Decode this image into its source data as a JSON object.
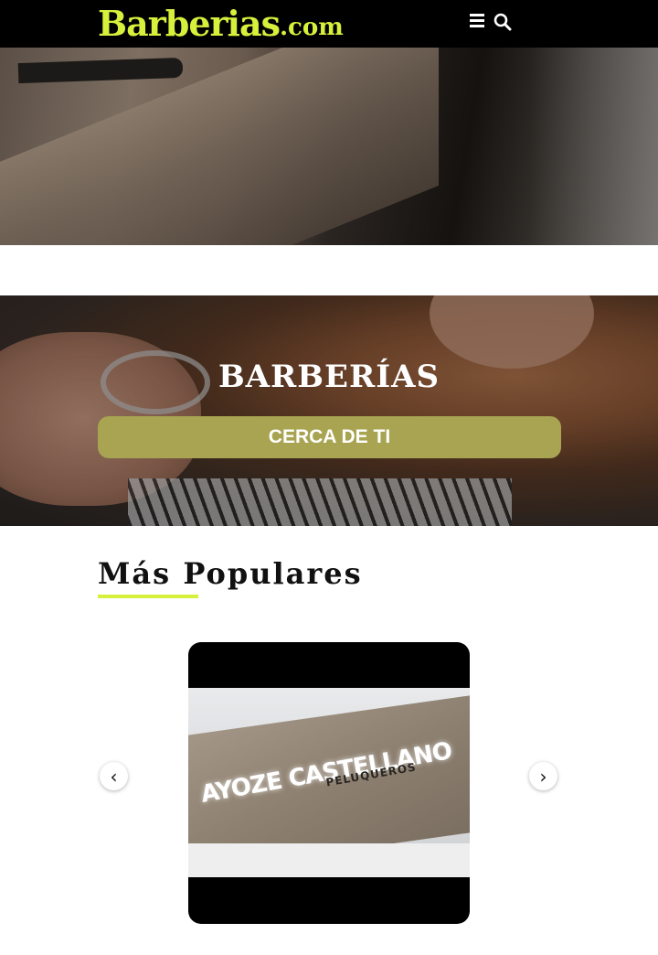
{
  "header": {
    "logo_main": "Barberias",
    "logo_tld": ".com",
    "icons": {
      "menu": "hamburger-menu-icon",
      "search": "search-icon"
    }
  },
  "hero": {
    "title": "BARBERÍAS",
    "cta_label": "CERCA DE TI"
  },
  "popular": {
    "title": "Más Populares",
    "cards": [
      {
        "sign_main": "AYOZE CASTELLANO",
        "sign_sub": "PELUQUEROS"
      }
    ],
    "prev_icon": "chevron-left-icon",
    "next_icon": "chevron-right-icon"
  },
  "colors": {
    "brand": "#d7f03c",
    "cta": "#a8a452",
    "header_bg": "#000000"
  }
}
